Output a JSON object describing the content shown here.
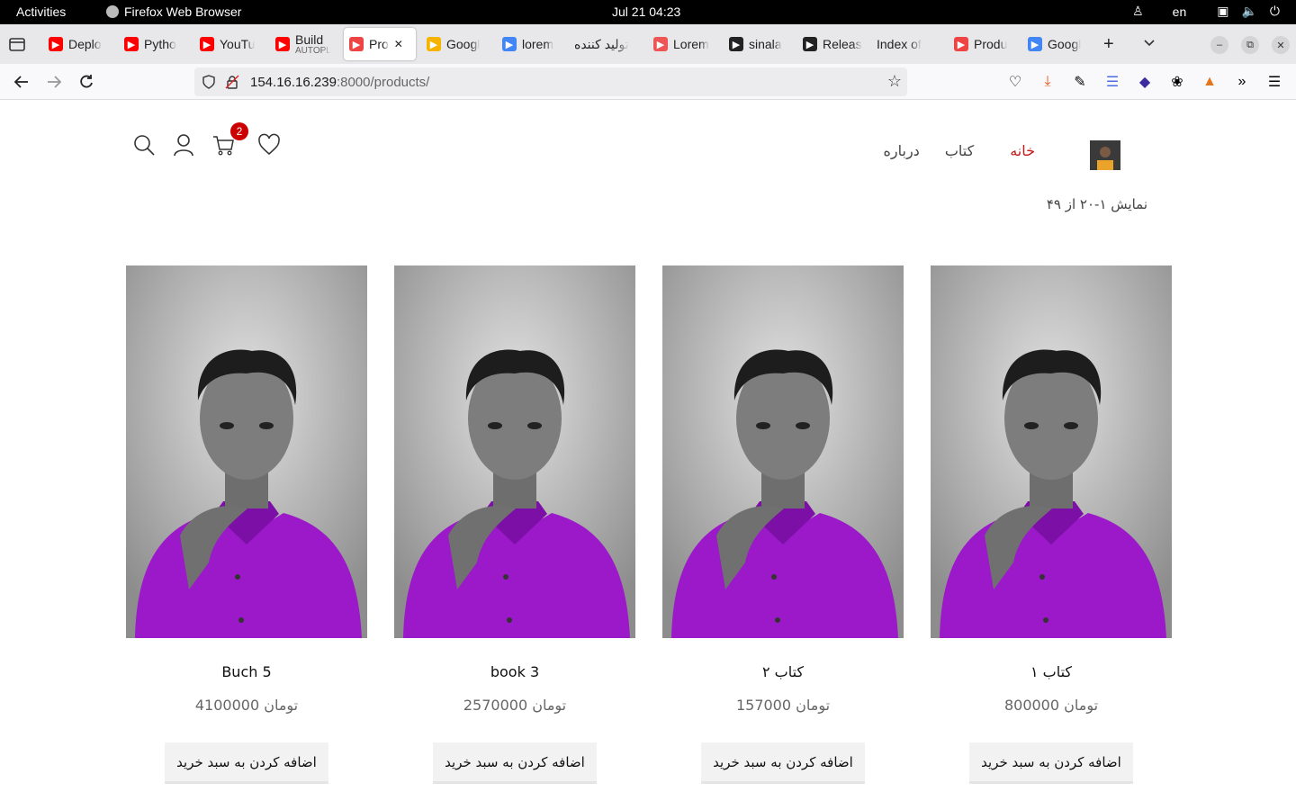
{
  "os": {
    "activities": "Activities",
    "app_name": "Firefox Web Browser",
    "clock": "Jul 21  04:23",
    "lang": "en"
  },
  "tabs": [
    {
      "label": "Deplo",
      "favicon": "youtube-icon",
      "color": "#ff0000"
    },
    {
      "label": "Pytho",
      "favicon": "youtube-icon",
      "color": "#ff0000"
    },
    {
      "label": "YouTu",
      "favicon": "youtube-icon",
      "color": "#ff0000"
    },
    {
      "label": "Build",
      "sub": "AUTOPL",
      "favicon": "youtube-icon",
      "color": "#ff0000"
    },
    {
      "label": "Pro",
      "favicon": "site-h-icon",
      "color": "#e44",
      "active": true
    },
    {
      "label": "Googl",
      "favicon": "google-keep-icon",
      "color": "#f6b400"
    },
    {
      "label": "lorem",
      "favicon": "google-icon",
      "color": "#4285f4"
    },
    {
      "label": "تولید کننده",
      "favicon": "",
      "color": "#999"
    },
    {
      "label": "Lorem",
      "favicon": "lorem-icon",
      "color": "#e55"
    },
    {
      "label": "sinala",
      "favicon": "github-icon",
      "color": "#222"
    },
    {
      "label": "Releas",
      "favicon": "github-icon",
      "color": "#222"
    },
    {
      "label": "Index of",
      "favicon": "",
      "color": "#999"
    },
    {
      "label": "Produ",
      "favicon": "site-h-icon",
      "color": "#e44"
    },
    {
      "label": "Googl",
      "favicon": "google-translate-icon",
      "color": "#4285f4"
    }
  ],
  "address": {
    "host": "154.16.16.239",
    "rest": ":8000/products/"
  },
  "site": {
    "menu": [
      {
        "label": "خانه",
        "active": true
      },
      {
        "label": "کتاب",
        "active": false
      },
      {
        "label": "درباره",
        "active": false
      }
    ],
    "cart_count": "2",
    "showing": "نمایش ۱-۲۰ از ۴۹"
  },
  "products": [
    {
      "title": "Buch 5",
      "price": "4100000 تومان",
      "button": "اضافه کردن به سبد خرید"
    },
    {
      "title": "book 3",
      "price": "2570000 تومان",
      "button": "اضافه کردن به سبد خرید"
    },
    {
      "title": "کتاب ۲",
      "price": "157000 تومان",
      "button": "اضافه کردن به سبد خرید"
    },
    {
      "title": "کتاب ۱",
      "price": "800000 تومان",
      "button": "اضافه کردن به سبد خرید"
    }
  ],
  "colors": {
    "accent": "#c41a1a",
    "shirt": "#9b19c9"
  }
}
